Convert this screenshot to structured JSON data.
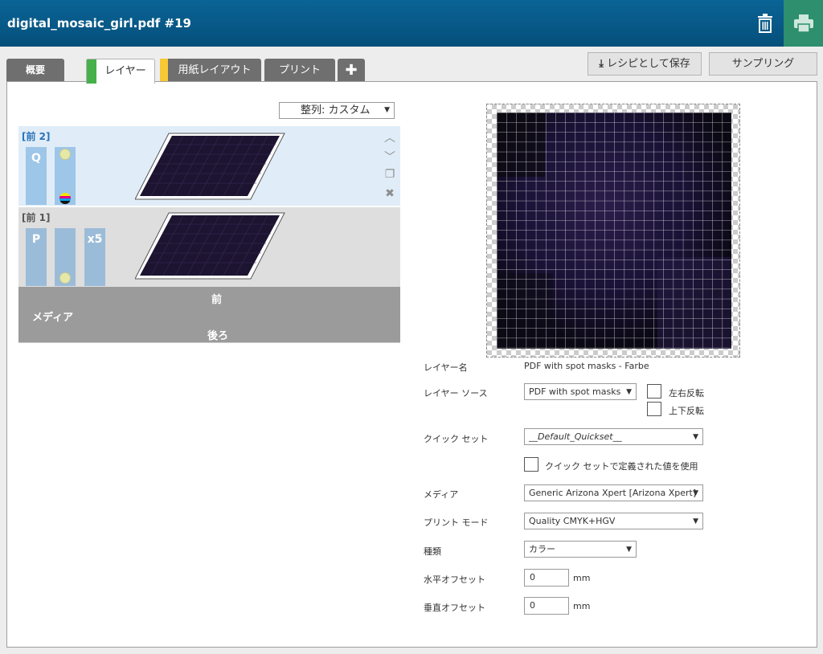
{
  "header": {
    "title": "digital_mosaic_girl.pdf #19"
  },
  "tabs": {
    "overview": "概要",
    "layers": "レイヤー",
    "paper_layout": "用紙レイアウト",
    "print": "プリント",
    "add": "+"
  },
  "toolbar": {
    "save_recipe": "レシピとして保存",
    "sampling": "サンプリング"
  },
  "sort": {
    "label": "整列: カスタム"
  },
  "layers": [
    {
      "label": "[前 2]",
      "chips": [
        "Q",
        "",
        ""
      ]
    },
    {
      "label": "[前 1]",
      "chips": [
        "P",
        "",
        "x5"
      ]
    }
  ],
  "media_stack": {
    "front": "前",
    "media": "メディア",
    "back": "後ろ"
  },
  "form": {
    "layer_name_label": "レイヤー名",
    "layer_name_value": "PDF with spot masks - Farbe",
    "layer_source_label": "レイヤー ソース",
    "layer_source_value": "PDF with spot masks",
    "flip_horizontal": "左右反転",
    "flip_vertical": "上下反転",
    "quickset_label": "クイック セット",
    "quickset_value": "__Default_Quickset__",
    "use_quickset_values": "クイック セットで定義された値を使用",
    "media_label": "メディア",
    "media_value": "Generic Arizona Xpert [Arizona Xpert]",
    "print_mode_label": "プリント モード",
    "print_mode_value": "Quality CMYK+HGV",
    "type_label": "種類",
    "type_value": "カラー",
    "h_offset_label": "水平オフセット",
    "h_offset_value": "0",
    "v_offset_label": "垂直オフセット",
    "v_offset_value": "0",
    "unit": "mm"
  },
  "icons": {
    "delete": "trash-icon",
    "print": "printer-icon",
    "download": "download-icon",
    "up": "chevron-up-icon",
    "down": "chevron-down-icon",
    "copy": "copy-icon",
    "remove": "close-icon"
  },
  "colors": {
    "header": "#055a89",
    "print_button": "#2d8f6d",
    "layers_tab_accent": "#46b04a",
    "paper_tab_accent": "#f7c935",
    "layer_selected_bg": "#e0edf8"
  }
}
